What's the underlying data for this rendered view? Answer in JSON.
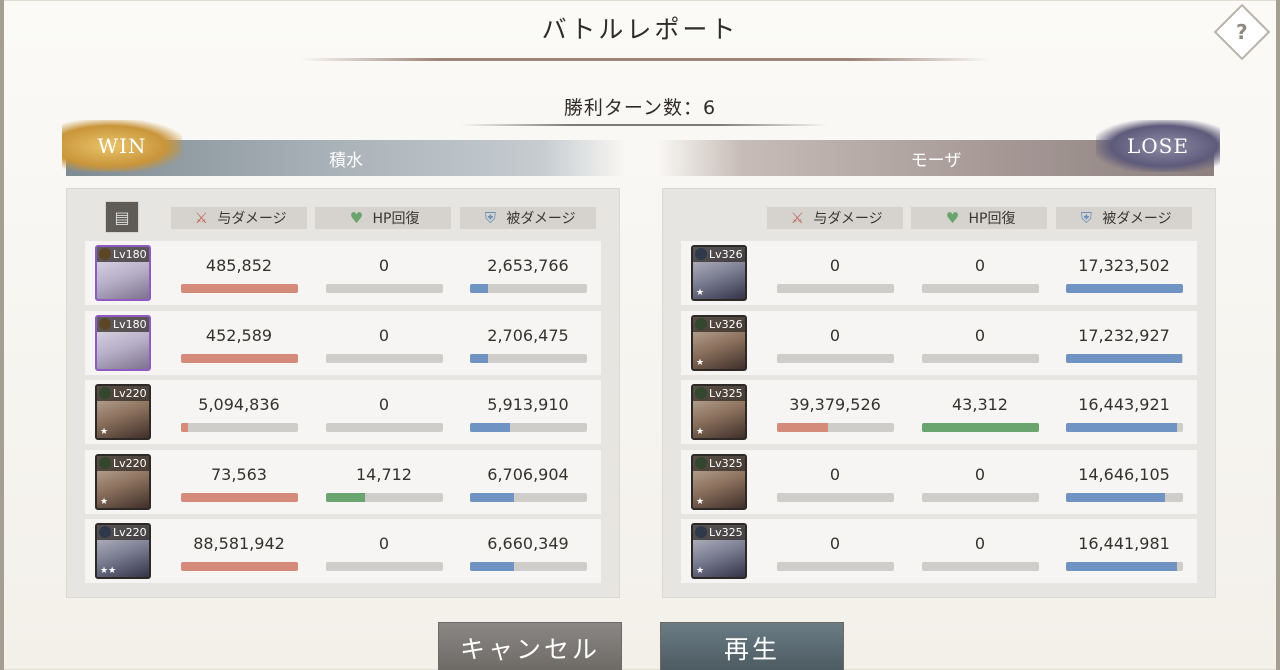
{
  "title": "バトルレポート",
  "help_label": "?",
  "turns_label": "勝利ターン数：6",
  "columns": {
    "damage_dealt": "与ダメージ",
    "hp_recovery": "HP回復",
    "damage_taken": "被ダメージ"
  },
  "left_team": {
    "result": "WIN",
    "name": "積水",
    "members": [
      {
        "level": "Lv180",
        "element": "light",
        "frame": "purple",
        "stars": "",
        "dealt": "485,852",
        "dealt_ratio": 1.0,
        "healed": "0",
        "healed_ratio": 0,
        "taken": "2,653,766",
        "taken_ratio": 0.15
      },
      {
        "level": "Lv180",
        "element": "light",
        "frame": "purple",
        "stars": "",
        "dealt": "452,589",
        "dealt_ratio": 1.0,
        "healed": "0",
        "healed_ratio": 0,
        "taken": "2,706,475",
        "taken_ratio": 0.15
      },
      {
        "level": "Lv220",
        "element": "wind",
        "frame": "normal",
        "stars": "★",
        "dealt": "5,094,836",
        "dealt_ratio": 0.06,
        "healed": "0",
        "healed_ratio": 0,
        "taken": "5,913,910",
        "taken_ratio": 0.34
      },
      {
        "level": "Lv220",
        "element": "wind",
        "frame": "normal",
        "stars": "★",
        "dealt": "73,563",
        "dealt_ratio": 1.0,
        "healed": "14,712",
        "healed_ratio": 0.33,
        "taken": "6,706,904",
        "taken_ratio": 0.38
      },
      {
        "level": "Lv220",
        "element": "water",
        "frame": "normal",
        "stars": "★★",
        "dealt": "88,581,942",
        "dealt_ratio": 1.0,
        "healed": "0",
        "healed_ratio": 0,
        "taken": "6,660,349",
        "taken_ratio": 0.38
      }
    ]
  },
  "right_team": {
    "result": "LOSE",
    "name": "モーザ",
    "members": [
      {
        "level": "Lv326",
        "element": "water",
        "frame": "normal",
        "stars": "★",
        "dealt": "0",
        "dealt_ratio": 0,
        "healed": "0",
        "healed_ratio": 0,
        "taken": "17,323,502",
        "taken_ratio": 1.0
      },
      {
        "level": "Lv326",
        "element": "wind",
        "frame": "normal",
        "stars": "★",
        "dealt": "0",
        "dealt_ratio": 0,
        "healed": "0",
        "healed_ratio": 0,
        "taken": "17,232,927",
        "taken_ratio": 0.99
      },
      {
        "level": "Lv325",
        "element": "wind",
        "frame": "normal",
        "stars": "★",
        "dealt": "39,379,526",
        "dealt_ratio": 0.44,
        "healed": "43,312",
        "healed_ratio": 1.0,
        "taken": "16,443,921",
        "taken_ratio": 0.95
      },
      {
        "level": "Lv325",
        "element": "wind",
        "frame": "normal",
        "stars": "★",
        "dealt": "0",
        "dealt_ratio": 0,
        "healed": "0",
        "healed_ratio": 0,
        "taken": "14,646,105",
        "taken_ratio": 0.85
      },
      {
        "level": "Lv325",
        "element": "water",
        "frame": "normal",
        "stars": "★",
        "dealt": "0",
        "dealt_ratio": 0,
        "healed": "0",
        "healed_ratio": 0,
        "taken": "16,441,981",
        "taken_ratio": 0.95
      }
    ]
  },
  "buttons": {
    "cancel": "キャンセル",
    "play": "再生"
  },
  "colors": {
    "damage_bar": "#d58b7a",
    "heal_bar": "#6aa46e",
    "taken_bar": "#6f94c4"
  },
  "icons": {
    "damage_dealt": "sword-icon",
    "hp_recovery": "heart-icon",
    "damage_taken": "shield-icon",
    "filter": "document-icon"
  }
}
